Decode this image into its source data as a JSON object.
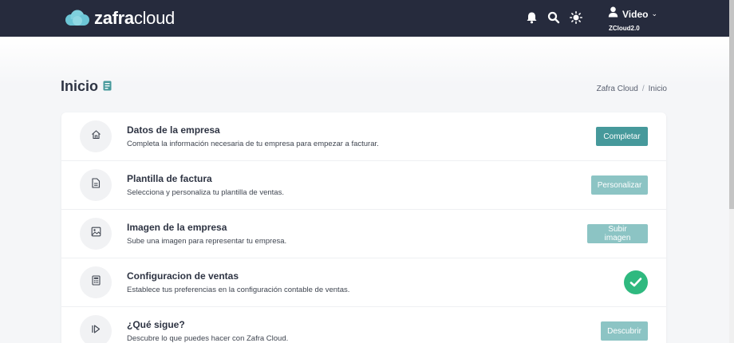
{
  "brand": {
    "bold": "zafra",
    "light": "cloud"
  },
  "topbar": {
    "icons": [
      "bell-icon",
      "search-icon",
      "sun-icon"
    ],
    "user": {
      "name": "Video",
      "subtitle": "ZCloud2.0",
      "icon": "user-icon"
    }
  },
  "page": {
    "title": "Inicio",
    "title_icon": "book-icon",
    "breadcrumb": [
      "Zafra Cloud",
      "Inicio"
    ],
    "breadcrumb_separator": "/"
  },
  "steps": [
    {
      "icon": "home-icon",
      "title": "Datos de la empresa",
      "description": "Completa la información necesaria de tu empresa para empezar a facturar.",
      "action": "Completar",
      "state": "active"
    },
    {
      "icon": "document-icon",
      "title": "Plantilla de factura",
      "description": "Selecciona y personaliza tu plantilla de ventas.",
      "action": "Personalizar",
      "state": "pending"
    },
    {
      "icon": "image-icon",
      "title": "Imagen de la empresa",
      "description": "Sube una imagen para representar tu empresa.",
      "action": "Subir imagen",
      "state": "pending"
    },
    {
      "icon": "calculator-icon",
      "title": "Configuracion de ventas",
      "description": "Establece tus preferencias en la configuración contable de ventas.",
      "action": "",
      "state": "done"
    },
    {
      "icon": "play-icon",
      "title": "¿Qué sigue?",
      "description": "Descubre lo que puedes hacer con Zafra Cloud.",
      "action": "Descubrir",
      "state": "pending"
    }
  ],
  "colors": {
    "topbar": "#262b3d",
    "button_primary": "#46999b",
    "button_faded": "#8cc4c4",
    "success": "#2fb97f",
    "cloud": "#6cc6d6"
  }
}
